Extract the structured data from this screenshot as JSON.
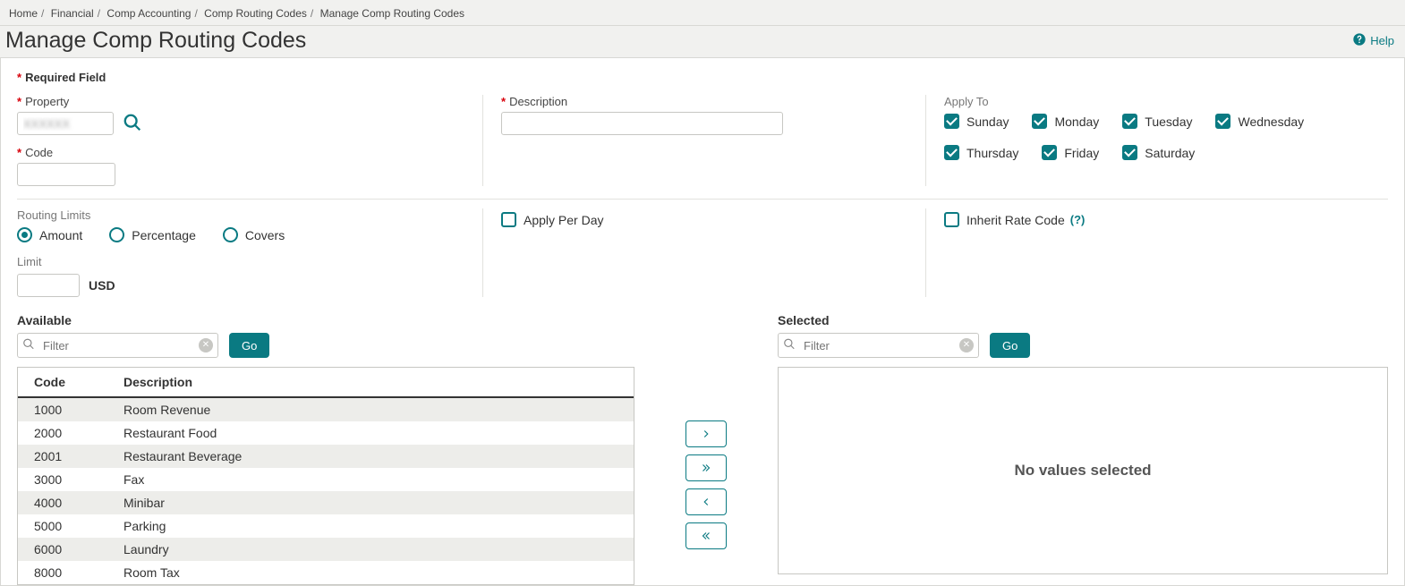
{
  "breadcrumb": [
    "Home",
    "Financial",
    "Comp Accounting",
    "Comp Routing Codes",
    "Manage Comp Routing Codes"
  ],
  "page_title": "Manage Comp Routing Codes",
  "help_label": "Help",
  "required_legend": "Required Field",
  "fields": {
    "property_label": "Property",
    "property_value": "XXXXXX",
    "code_label": "Code",
    "code_value": "",
    "description_label": "Description",
    "description_value": "",
    "apply_to_label": "Apply To",
    "days": [
      {
        "label": "Sunday",
        "checked": true
      },
      {
        "label": "Monday",
        "checked": true
      },
      {
        "label": "Tuesday",
        "checked": true
      },
      {
        "label": "Wednesday",
        "checked": true
      },
      {
        "label": "Thursday",
        "checked": true
      },
      {
        "label": "Friday",
        "checked": true
      },
      {
        "label": "Saturday",
        "checked": true
      }
    ]
  },
  "routing_limits": {
    "label": "Routing Limits",
    "options": [
      {
        "label": "Amount",
        "selected": true
      },
      {
        "label": "Percentage",
        "selected": false
      },
      {
        "label": "Covers",
        "selected": false
      }
    ],
    "limit_label": "Limit",
    "limit_value": "",
    "currency": "USD"
  },
  "apply_per_day": {
    "label": "Apply Per Day",
    "checked": false
  },
  "inherit_rate_code": {
    "label": "Inherit Rate Code",
    "checked": false,
    "help": "(?)"
  },
  "available": {
    "title": "Available",
    "filter_placeholder": "Filter",
    "go_label": "Go",
    "columns": [
      "Code",
      "Description"
    ],
    "rows": [
      {
        "code": "1000",
        "desc": "Room Revenue"
      },
      {
        "code": "2000",
        "desc": "Restaurant Food"
      },
      {
        "code": "2001",
        "desc": "Restaurant Beverage"
      },
      {
        "code": "3000",
        "desc": "Fax"
      },
      {
        "code": "4000",
        "desc": "Minibar"
      },
      {
        "code": "5000",
        "desc": "Parking"
      },
      {
        "code": "6000",
        "desc": "Laundry"
      },
      {
        "code": "8000",
        "desc": "Room Tax"
      }
    ]
  },
  "selected": {
    "title": "Selected",
    "filter_placeholder": "Filter",
    "go_label": "Go",
    "empty_text": "No values selected"
  }
}
